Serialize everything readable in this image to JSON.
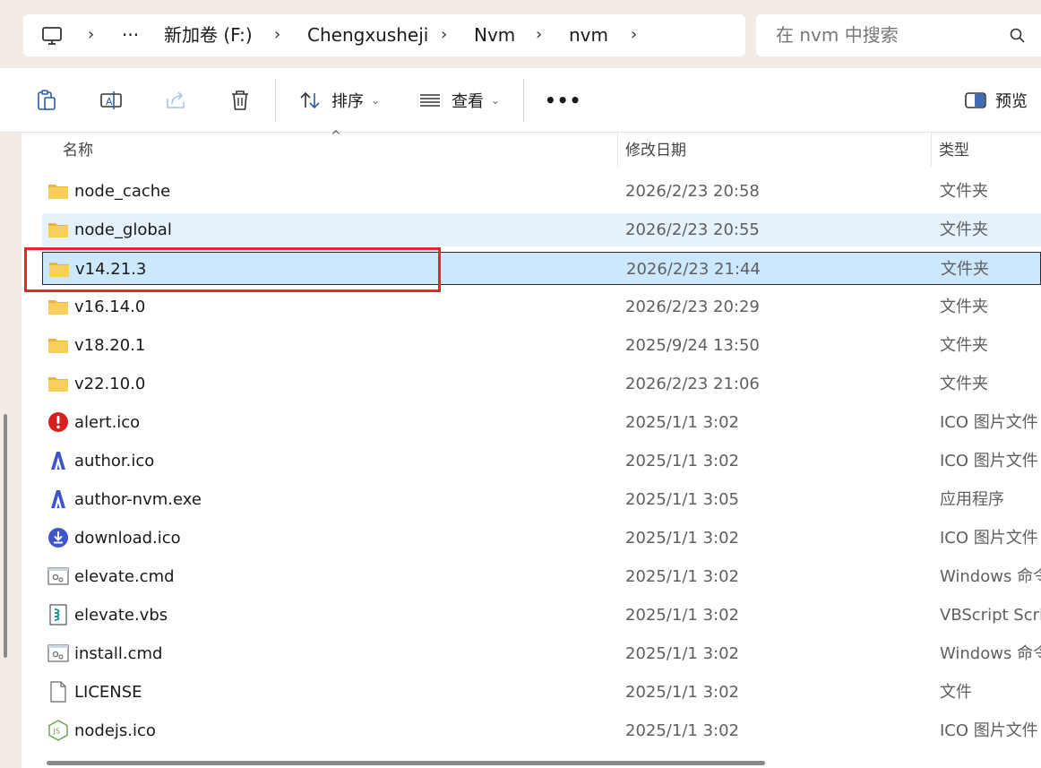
{
  "address_bar": {
    "icon": "computer-icon",
    "more": "···",
    "crumbs": [
      "新加卷 (F:)",
      "Chengxusheji",
      "Nvm",
      "nvm"
    ]
  },
  "search": {
    "placeholder": "在 nvm 中搜索",
    "icon": "search-icon"
  },
  "toolbar": {
    "sort_label": "排序",
    "view_label": "查看",
    "more_label": "•••",
    "preview_label": "预览",
    "icons": [
      "paste-icon",
      "rename-icon",
      "share-icon",
      "delete-icon",
      "sort-icon",
      "view-icon",
      "preview-pane-icon"
    ]
  },
  "columns": {
    "name": "名称",
    "date": "修改日期",
    "type": "类型"
  },
  "files": [
    {
      "name": "node_cache",
      "date": "2026/2/23 20:58",
      "type": "文件夹",
      "icon": "folder-icon"
    },
    {
      "name": "node_global",
      "date": "2026/2/23 20:55",
      "type": "文件夹",
      "icon": "folder-icon"
    },
    {
      "name": "v14.21.3",
      "date": "2026/2/23 21:44",
      "type": "文件夹",
      "icon": "folder-icon"
    },
    {
      "name": "v16.14.0",
      "date": "2026/2/23 20:29",
      "type": "文件夹",
      "icon": "folder-icon"
    },
    {
      "name": "v18.20.1",
      "date": "2025/9/24 13:50",
      "type": "文件夹",
      "icon": "folder-icon"
    },
    {
      "name": "v22.10.0",
      "date": "2026/2/23 21:06",
      "type": "文件夹",
      "icon": "folder-icon"
    },
    {
      "name": "alert.ico",
      "date": "2025/1/1 3:02",
      "type": "ICO 图片文件",
      "icon": "alert-icon"
    },
    {
      "name": "author.ico",
      "date": "2025/1/1 3:02",
      "type": "ICO 图片文件",
      "icon": "author-icon"
    },
    {
      "name": "author-nvm.exe",
      "date": "2025/1/1 3:05",
      "type": "应用程序",
      "icon": "author-icon"
    },
    {
      "name": "download.ico",
      "date": "2025/1/1 3:02",
      "type": "ICO 图片文件",
      "icon": "download-icon"
    },
    {
      "name": "elevate.cmd",
      "date": "2025/1/1 3:02",
      "type": "Windows 命令",
      "icon": "cmd-icon"
    },
    {
      "name": "elevate.vbs",
      "date": "2025/1/1 3:02",
      "type": "VBScript Script",
      "icon": "vbs-icon"
    },
    {
      "name": "install.cmd",
      "date": "2025/1/1 3:02",
      "type": "Windows 命令",
      "icon": "cmd-icon"
    },
    {
      "name": "LICENSE",
      "date": "2025/1/1 3:02",
      "type": "文件",
      "icon": "file-icon"
    },
    {
      "name": "nodejs.ico",
      "date": "2025/1/1 3:02",
      "type": "ICO 图片文件",
      "icon": "nodejs-icon"
    }
  ],
  "hover_row": 1,
  "selected_row": 2,
  "colors": {
    "accent": "#0067c0",
    "selection": "#cce8ff",
    "hover": "#e5f1fb",
    "highlight": "#e8242d",
    "folder": "#f8c84a"
  }
}
